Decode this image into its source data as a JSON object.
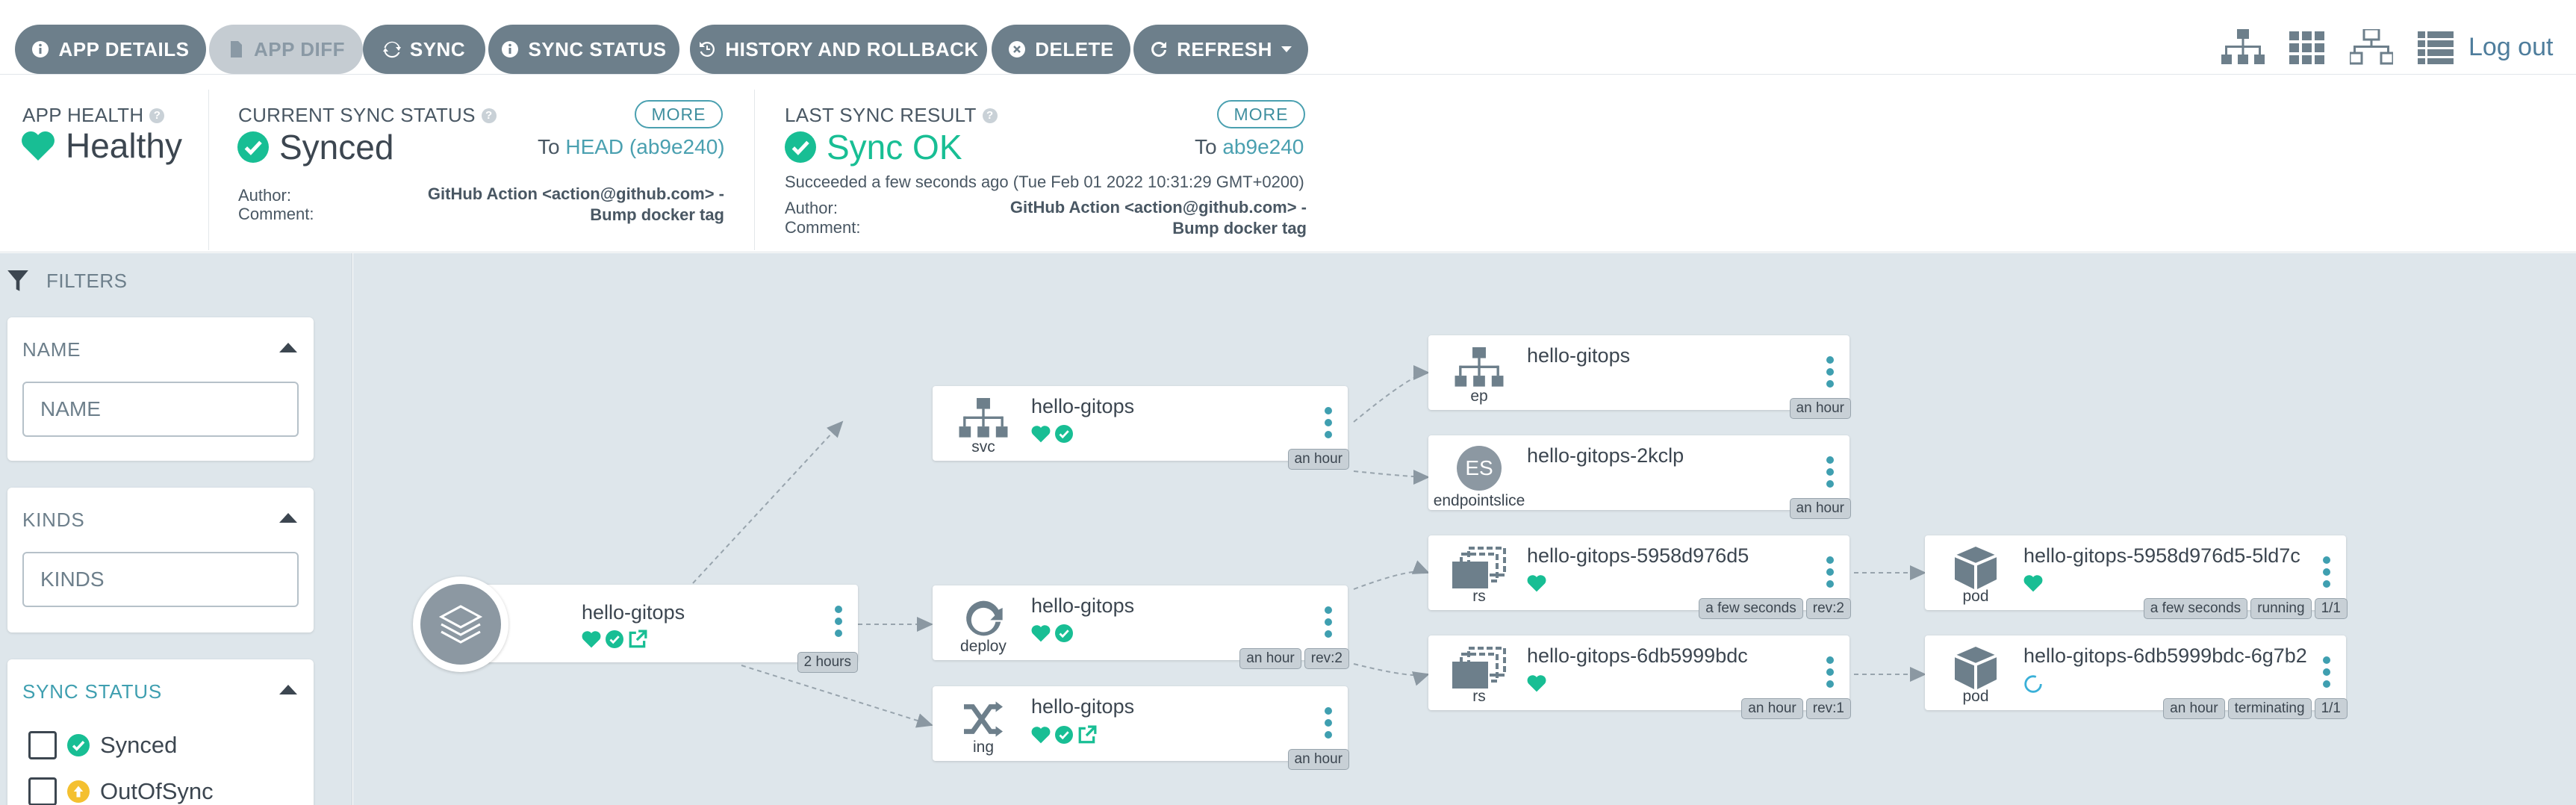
{
  "toolbar": {
    "buttons": [
      {
        "label": "APP DETAILS",
        "icon": "info-circle-icon"
      },
      {
        "label": "APP DIFF",
        "icon": "file-icon",
        "disabled": true
      },
      {
        "label": "SYNC",
        "icon": "sync-icon"
      },
      {
        "label": "SYNC STATUS",
        "icon": "info-circle-icon"
      },
      {
        "label": "HISTORY AND ROLLBACK",
        "icon": "history-icon"
      },
      {
        "label": "DELETE",
        "icon": "times-circle-icon"
      },
      {
        "label": "REFRESH",
        "icon": "redo-icon"
      }
    ],
    "view_icons": [
      "tree-view-icon",
      "pods-view-icon",
      "network-view-icon",
      "list-view-icon"
    ],
    "logout": "Log out"
  },
  "status": {
    "health": {
      "label": "APP HEALTH",
      "value": "Healthy"
    },
    "sync": {
      "label": "CURRENT SYNC STATUS",
      "value": "Synced",
      "more": "MORE",
      "to_prefix": "To",
      "to_ref": "HEAD (ab9e240)",
      "author_label": "Author:",
      "comment_label": "Comment:",
      "author": "GitHub Action <action@github.com> -",
      "comment": "Bump docker tag"
    },
    "last": {
      "label": "LAST SYNC RESULT",
      "value": "Sync OK",
      "more": "MORE",
      "to_prefix": "To",
      "to_ref": "ab9e240",
      "succeeded": "Succeeded a few seconds ago (Tue Feb 01 2022 10:31:29 GMT+0200)",
      "author_label": "Author:",
      "comment_label": "Comment:",
      "author": "GitHub Action <action@github.com> -",
      "comment": "Bump docker tag"
    }
  },
  "filters": {
    "title": "FILTERS",
    "name": {
      "title": "NAME",
      "placeholder": "NAME"
    },
    "kinds": {
      "title": "KINDS",
      "placeholder": "KINDS"
    },
    "sync_status": {
      "title": "SYNC STATUS",
      "options": [
        "Synced",
        "OutOfSync"
      ]
    }
  },
  "graph": {
    "app": {
      "name": "hello-gitops",
      "age": "2 hours"
    },
    "nodes": [
      {
        "name": "hello-gitops",
        "kind": "svc",
        "tags": [
          "an hour"
        ]
      },
      {
        "name": "hello-gitops",
        "kind": "deploy",
        "tags": [
          "an hour",
          "rev:2"
        ]
      },
      {
        "name": "hello-gitops",
        "kind": "ing",
        "tags": [
          "an hour"
        ]
      },
      {
        "name": "hello-gitops",
        "kind": "ep",
        "tags": [
          "an hour"
        ]
      },
      {
        "name": "hello-gitops-2kclp",
        "kind": "endpointslice",
        "icon_text": "ES",
        "tags": [
          "an hour"
        ]
      },
      {
        "name": "hello-gitops-5958d976d5",
        "kind": "rs",
        "tags": [
          "a few seconds",
          "rev:2"
        ]
      },
      {
        "name": "hello-gitops-6db5999bdc",
        "kind": "rs",
        "tags": [
          "an hour",
          "rev:1"
        ]
      },
      {
        "name": "hello-gitops-5958d976d5-5ld7c",
        "kind": "pod",
        "tags": [
          "a few seconds",
          "running",
          "1/1"
        ]
      },
      {
        "name": "hello-gitops-6db5999bdc-6g7b2",
        "kind": "pod",
        "tags": [
          "an hour",
          "terminating",
          "1/1"
        ]
      }
    ]
  },
  "colors": {
    "healthy": "#18be94",
    "synced": "#18be94",
    "link": "#4aa0b0",
    "button": "#6d7f8b"
  }
}
